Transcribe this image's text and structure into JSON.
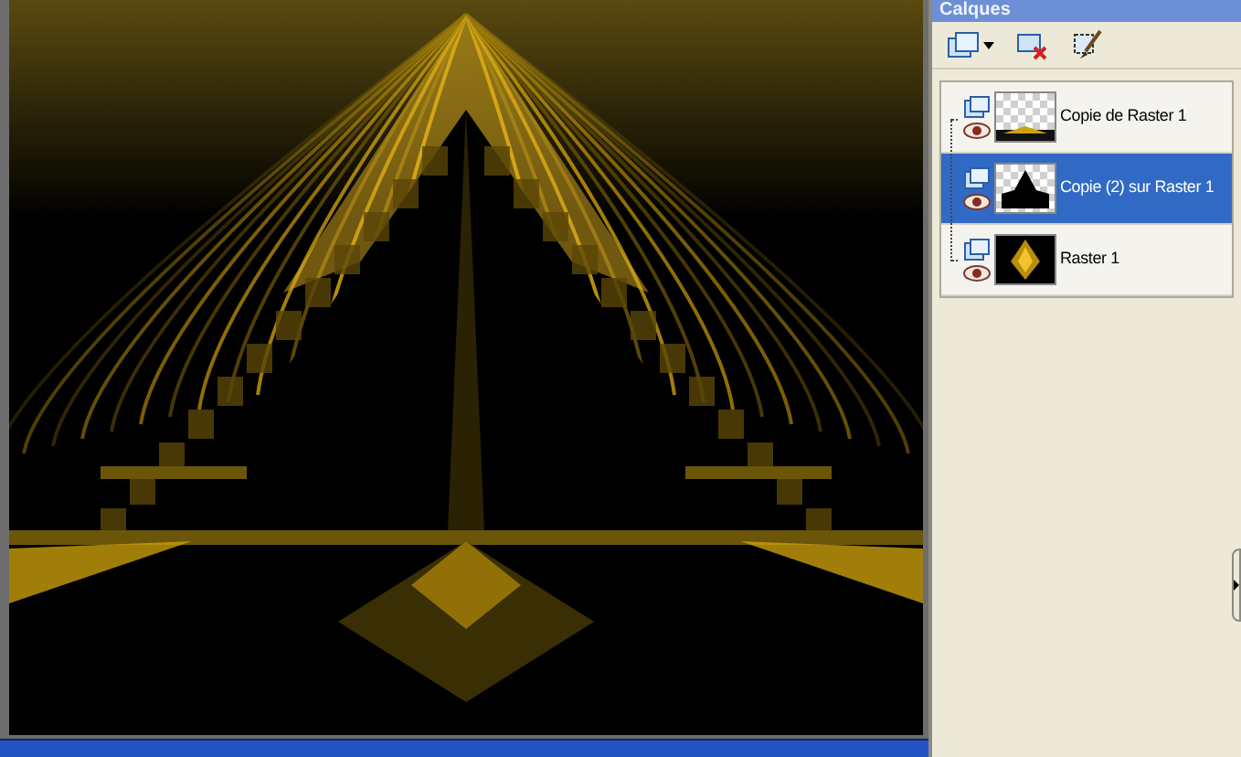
{
  "layers_panel": {
    "title": "Calques",
    "layers": [
      {
        "name": "Copie de Raster 1",
        "kind": "strip",
        "selected": false
      },
      {
        "name": "Copie (2) sur Raster 1",
        "kind": "peak",
        "selected": true
      },
      {
        "name": "Raster 1",
        "kind": "diamond",
        "selected": false
      }
    ]
  }
}
